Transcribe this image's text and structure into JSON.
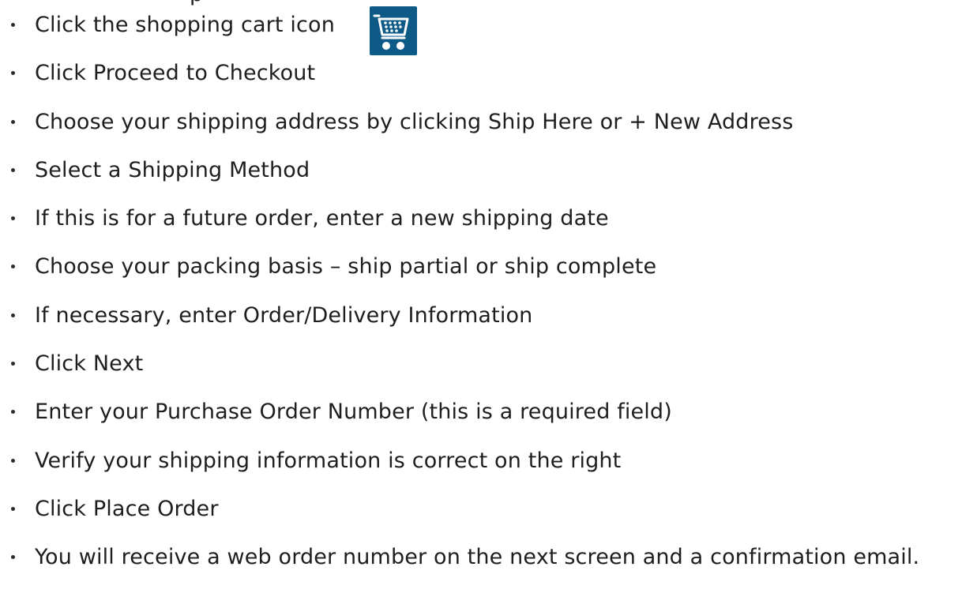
{
  "top_fragment": "p",
  "steps": [
    "Click the shopping cart icon",
    "Click Proceed to Checkout",
    "Choose your shipping address by clicking Ship Here or + New Address",
    "Select a Shipping Method",
    "If this is for a future order, enter a new shipping date",
    "Choose your packing basis – ship partial or ship complete",
    "If necessary, enter Order/Delivery Information",
    "Click Next",
    "Enter your Purchase Order Number (this is a required field)",
    "Verify your shipping information is correct on the right",
    "Click Place Order",
    "You will receive a web order number on the next screen and a confirmation email."
  ],
  "icons": {
    "cart": "shopping-cart-icon"
  },
  "colors": {
    "cart_icon_bg": "#0d5a87",
    "text": "#1e1e1e"
  }
}
